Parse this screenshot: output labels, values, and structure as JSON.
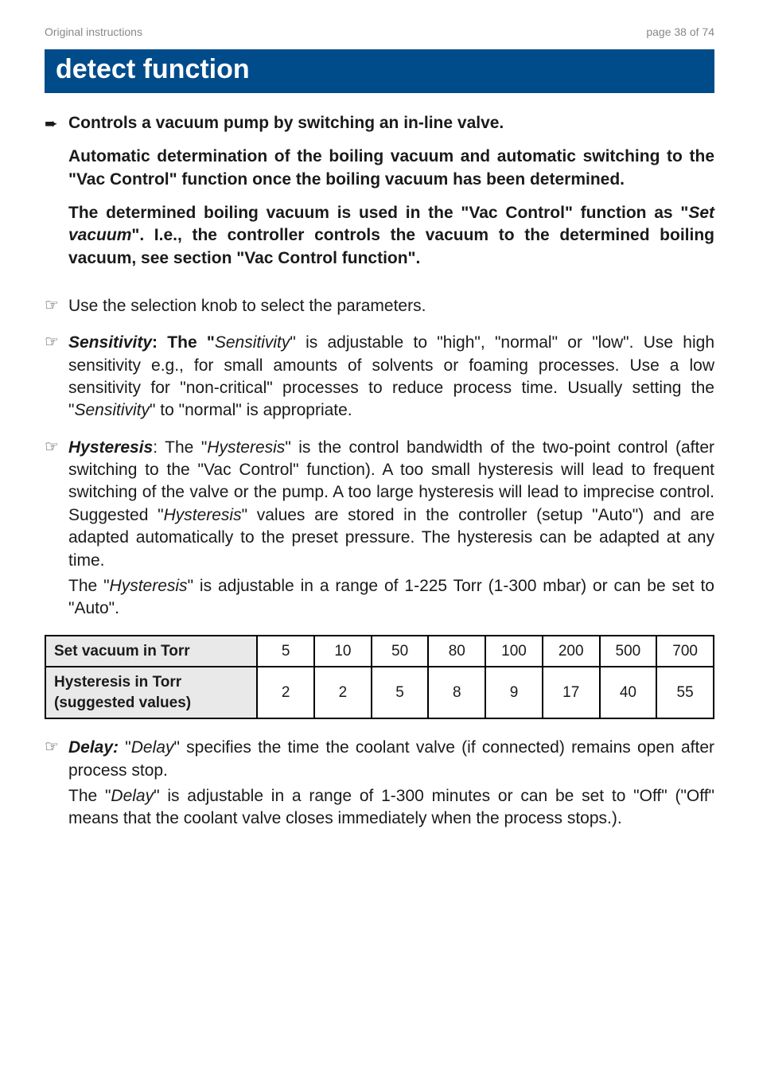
{
  "header": {
    "left": "Original instructions",
    "right": "page 38 of 74"
  },
  "banner": "detect function",
  "lead": {
    "line1": "Controls a vacuum pump by switching an in-line valve.",
    "p1": "Automatic determination of the boiling vacuum and automatic switching to the \"Vac Control\" function once the boiling vacuum has been determined.",
    "p2a": "The determined boiling vacuum is used in the \"Vac Control\" function as \"",
    "p2_set": "Set vacuum",
    "p2b": "\". I.e., the controller controls the vacuum to the determined boiling vacuum, see section \"Vac Control function\"."
  },
  "bullets": {
    "use_knob": "Use the selection knob to select the parameters.",
    "sens_label": "Sensitivity",
    "sens_a": ": The \"",
    "sens_i1": "Sensitivity",
    "sens_b": "\" is adjustable to \"high\", \"normal\" or \"low\". Use high sensitivity e.g., for small amounts of solvents or foaming processes. Use a low sensitivity for \"non-critical\" processes to reduce process time. Usually setting the \"",
    "sens_i2": "Sensitivity",
    "sens_c": "\" to \"normal\" is appropriate.",
    "hyst_label": "Hysteresis",
    "hyst_a": ": The \"",
    "hyst_i1": "Hysteresis",
    "hyst_b": "\" is the control bandwidth of the two-point control (after switching to the \"Vac Control\" function). A too small hysteresis will lead to frequent switching of the valve or the pump. A too large hysteresis will lead to imprecise control. Suggested \"",
    "hyst_i2": "Hysteresis",
    "hyst_c": "\" values are stored in the controller (setup \"Auto\") and are adapted automatically to the preset pressure. The hysteresis can be adapted at any time.",
    "hyst_sub_a": "The \"",
    "hyst_sub_i": "Hysteresis",
    "hyst_sub_b": "\" is adjustable in a range of 1-225 Torr (1-300 mbar) or can be set to \"Auto\".",
    "delay_label": "Delay:",
    "delay_a": " \"",
    "delay_i1": "Delay",
    "delay_b": "\" specifies the time the coolant valve (if connected) remains open after process stop.",
    "delay_sub_a": "The \"",
    "delay_sub_i": "Delay",
    "delay_sub_b": "\" is adjustable in a range of 1-300 minutes or can be set to \"Off\" (\"Off\" means that the coolant valve closes immediately when the process stops.)."
  },
  "table": {
    "row1_label": "Set vacuum in Torr",
    "row2_label": "Hysteresis in Torr (suggested values)",
    "set": [
      "5",
      "10",
      "50",
      "80",
      "100",
      "200",
      "500",
      "700"
    ],
    "hyst": [
      "2",
      "2",
      "5",
      "8",
      "9",
      "17",
      "40",
      "55"
    ]
  },
  "symbols": {
    "arrow": "➨",
    "hand": "☞"
  }
}
